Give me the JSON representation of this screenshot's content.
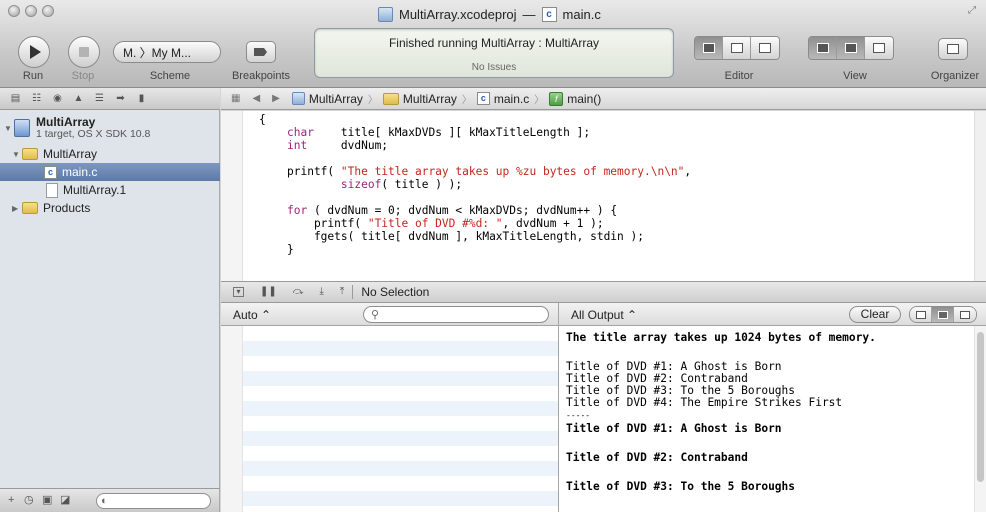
{
  "window": {
    "title": "MultiArray.xcodeproj",
    "title_separator": "—",
    "file": "main.c",
    "file_icon_glyph": "c",
    "controls": [
      "close",
      "minimize",
      "zoom"
    ]
  },
  "toolbar": {
    "run_label": "Run",
    "stop_label": "Stop",
    "scheme_label": "Scheme",
    "scheme_value": "M. 〉My M...",
    "breakpoints_label": "Breakpoints",
    "activity_title": "Finished running MultiArray : MultiArray",
    "activity_issues": "No Issues",
    "editor_label": "Editor",
    "view_label": "View",
    "organizer_label": "Organizer"
  },
  "navigator": {
    "tabs": [
      "folder-icon",
      "hierarchy-icon",
      "search-icon",
      "warning-icon",
      "list-icon",
      "breakpoint-icon",
      "log-icon"
    ],
    "project": {
      "name": "MultiArray",
      "subtitle": "1 target, OS X SDK 10.8"
    },
    "items": [
      {
        "label": "MultiArray",
        "kind": "folder"
      },
      {
        "label": "main.c",
        "kind": "c-file",
        "glyph": "c"
      },
      {
        "label": "MultiArray.1",
        "kind": "file"
      },
      {
        "label": "Products",
        "kind": "folder"
      }
    ],
    "filter_icons": [
      "plus-icon",
      "clock-icon",
      "grid-icon",
      "edit-icon"
    ]
  },
  "jumpbar": {
    "crumbs": [
      "MultiArray",
      "MultiArray",
      "main.c",
      "main()"
    ],
    "c_glyph": "c",
    "func_glyph": "f"
  },
  "editor": {
    "lines": [
      {
        "t": "{",
        "indent": 0
      },
      {
        "t": "char",
        "kw": true,
        "rest": "    title[ kMaxDVDs ][ kMaxTitleLength ];",
        "indent": 1
      },
      {
        "t": "int",
        "kw": true,
        "rest": "     dvdNum;",
        "indent": 1
      },
      {
        "t": "",
        "indent": 0
      },
      {
        "t": "printf( ",
        "str": "\"The title array takes up %zu bytes of memory.\\n\\n\"",
        "rest": ",",
        "indent": 1
      },
      {
        "t": "        ",
        "kw2": "sizeof",
        "rest": "( title ) );",
        "indent": 1
      },
      {
        "t": "",
        "indent": 0
      },
      {
        "t": "for",
        "kw": true,
        "rest": " ( dvdNum = 0; dvdNum < kMaxDVDs; dvdNum++ ) {",
        "indent": 1
      },
      {
        "t": "    printf( ",
        "str": "\"Title of DVD #%d: \"",
        "rest": ", dvdNum + 1 );",
        "indent": 1
      },
      {
        "t": "    fgets( title[ dvdNum ], kMaxTitleLength, stdin );",
        "indent": 1
      },
      {
        "t": "}",
        "indent": 1
      }
    ]
  },
  "debug": {
    "selection": "No Selection",
    "scope": "Auto ⌃",
    "console_filter": "All Output ⌃",
    "clear_label": "Clear"
  },
  "console": {
    "lines": [
      {
        "text": "The title array takes up 1024 bytes of memory.",
        "bold": true
      },
      {
        "text": "",
        "bold": false
      },
      {
        "text": "Title of DVD #1: A Ghost is Born",
        "bold": false
      },
      {
        "text": "Title of DVD #2: Contraband",
        "bold": false
      },
      {
        "text": "Title of DVD #3: To the 5 Boroughs",
        "bold": false
      },
      {
        "text": "Title of DVD #4: The Empire Strikes First",
        "bold": false
      },
      {
        "text": "-----",
        "bold": false
      },
      {
        "text": "Title of DVD #1: A Ghost is Born",
        "bold": true
      },
      {
        "text": "",
        "bold": false
      },
      {
        "text": "Title of DVD #2: Contraband",
        "bold": true
      },
      {
        "text": "",
        "bold": false
      },
      {
        "text": "Title of DVD #3: To the 5 Boroughs",
        "bold": true
      }
    ]
  }
}
